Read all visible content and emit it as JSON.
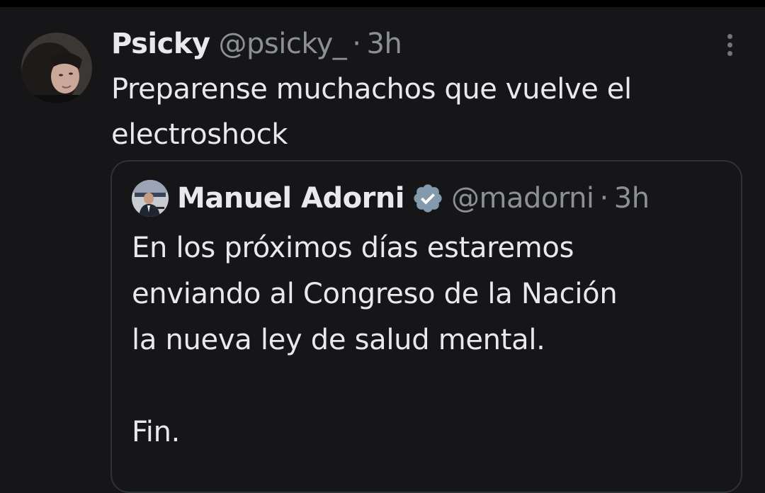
{
  "tweet": {
    "author": {
      "display_name": "Psicky",
      "handle": "@psicky_",
      "separator": "·",
      "time": "3h"
    },
    "text_line1": "Preparense muchachos que vuelve el",
    "text_line2": "electroshock",
    "quoted_tweet": {
      "author": {
        "display_name": "Manuel Adorni",
        "handle": "@madorni",
        "separator": "·",
        "time": "3h",
        "verified": true
      },
      "lines": [
        "En los próximos días estaremos",
        "enviando al Congreso de la Nación",
        "la nueva ley de salud mental.",
        "",
        "Fin."
      ]
    }
  },
  "icons": {
    "more": "more-vertical-icon",
    "verified": "verified-badge-icon"
  },
  "colors": {
    "background": "#161618",
    "text": "#e7e9ea",
    "secondary_text": "#8b9096",
    "border": "#2f3336",
    "verified": "#829aab"
  }
}
